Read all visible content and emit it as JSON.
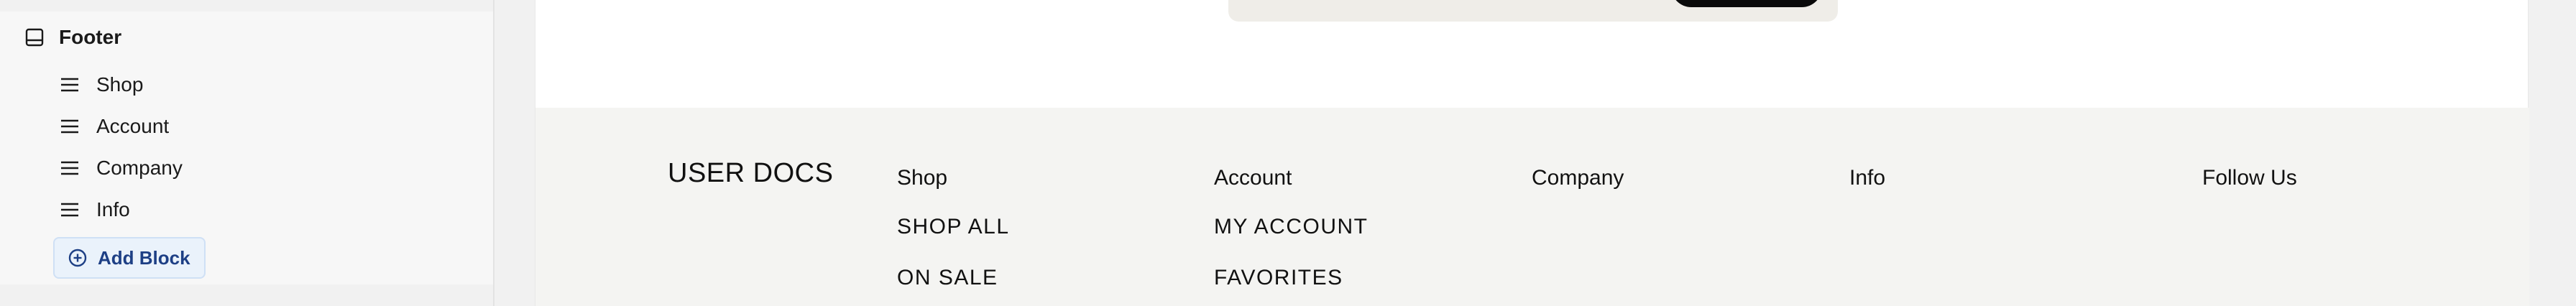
{
  "sidebar": {
    "section": {
      "label": "Footer",
      "icon": "panel-bottom-icon"
    },
    "items": [
      {
        "label": "Shop",
        "icon": "drag-handle-icon"
      },
      {
        "label": "Account",
        "icon": "drag-handle-icon"
      },
      {
        "label": "Company",
        "icon": "drag-handle-icon"
      },
      {
        "label": "Info",
        "icon": "drag-handle-icon"
      }
    ],
    "add_block": {
      "label": "Add Block",
      "icon": "plus-circle-icon"
    }
  },
  "preview": {
    "footer": {
      "brand": "USER DOCS",
      "columns": [
        {
          "heading": "Shop",
          "links": [
            "SHOP ALL",
            "ON SALE"
          ]
        },
        {
          "heading": "Account",
          "links": [
            "MY ACCOUNT",
            "FAVORITES"
          ]
        },
        {
          "heading": "Company",
          "links": []
        },
        {
          "heading": "Info",
          "links": []
        },
        {
          "heading": "Follow Us",
          "links": []
        }
      ]
    }
  },
  "colors": {
    "accent": "#1d3f85",
    "add_block_bg": "#eaf2fb",
    "footer_bg": "#f4f4f2",
    "newsletter_bg": "#efede8"
  }
}
